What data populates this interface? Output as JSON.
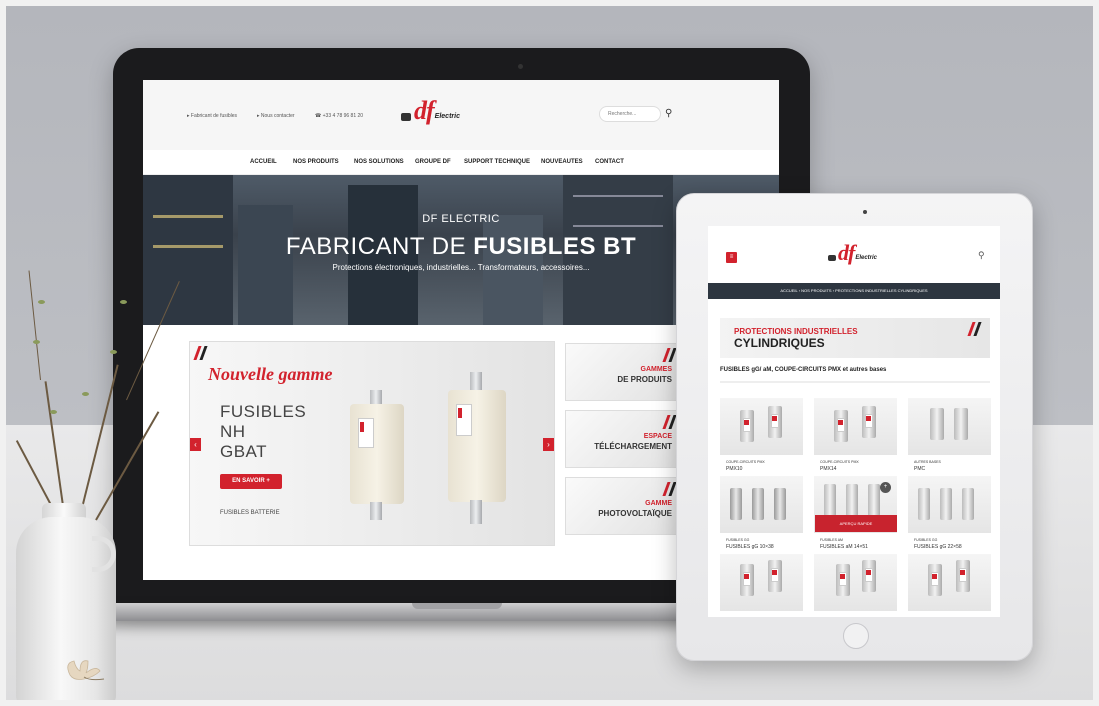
{
  "laptop_site": {
    "topbar": {
      "link1": "▸ Fabricant de fusibles",
      "link2": "▸ Nous contacter",
      "phone": "☎ +33 4 78 96 81 20",
      "logo_main": "df",
      "logo_sub": "Electric",
      "search_placeholder": "Recherche..."
    },
    "nav": [
      "ACCUEIL",
      "NOS PRODUITS",
      "NOS SOLUTIONS",
      "GROUPE DF",
      "SUPPORT TECHNIQUE",
      "NOUVEAUTES",
      "CONTACT"
    ],
    "hero": {
      "tagline": "DF ELECTRIC",
      "title_light": "FABRICANT DE ",
      "title_bold": "FUSIBLES BT",
      "subtitle": "Protections électroniques, industrielles... Transformateurs, accessoires..."
    },
    "slider": {
      "badge": "Nouvelle gamme",
      "lines": [
        "FUSIBLES",
        "NH",
        "GBAT"
      ],
      "cta": "EN SAVOIR +",
      "caption": "FUSIBLES BATTERIE",
      "prev": "‹",
      "next": "›"
    },
    "side_cards": [
      {
        "red": "GAMMES",
        "dark": "DE PRODUITS"
      },
      {
        "red": "ESPACE",
        "dark": "TÉLÉCHARGEMENT"
      },
      {
        "red": "GAMME",
        "dark": "PHOTOVOLTAÏQUE"
      }
    ]
  },
  "tablet_site": {
    "menu_icon": "≡",
    "logo_main": "df",
    "logo_sub": "Electric",
    "breadcrumb": "ACCUEIL  ›  NOS PRODUITS  ›  PROTECTIONS INDUSTRIELLES CYLINDRIQUES",
    "banner_red": "PROTECTIONS INDUSTRIELLES",
    "banner_dark": "CYLINDRIQUES",
    "heading": "FUSIBLES gG/ aM, COUPE-CIRCUITS PMX et autres bases",
    "apercu": "APERÇU RAPIDE",
    "products": [
      {
        "cat": "COUPE-CIRCUITS PMX",
        "name": "PMX10"
      },
      {
        "cat": "COUPE-CIRCUITS PMX",
        "name": "PMX14"
      },
      {
        "cat": "AUTRES BASES",
        "name": "PMC"
      },
      {
        "cat": "FUSIBLES GG",
        "name": "FUSIBLES gG 10×38"
      },
      {
        "cat": "FUSIBLES AM",
        "name": "FUSIBLES aM 14×51"
      },
      {
        "cat": "FUSIBLES GG",
        "name": "FUSIBLES gG 22×58"
      },
      {
        "cat": "",
        "name": ""
      },
      {
        "cat": "",
        "name": ""
      },
      {
        "cat": "",
        "name": ""
      }
    ]
  },
  "colors": {
    "brand_red": "#d2222d",
    "dark": "#2d3640"
  }
}
